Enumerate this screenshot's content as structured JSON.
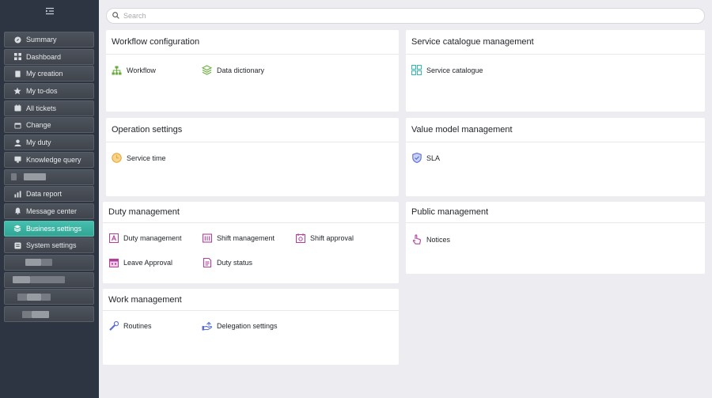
{
  "sidebar": {
    "items": [
      {
        "label": "Summary",
        "icon": "compass-icon"
      },
      {
        "label": "Dashboard",
        "icon": "grid-icon"
      },
      {
        "label": "My creation",
        "icon": "document-icon"
      },
      {
        "label": "My to-dos",
        "icon": "star-icon"
      },
      {
        "label": "All tickets",
        "icon": "ticket-icon"
      },
      {
        "label": "Change",
        "icon": "calendar-icon"
      },
      {
        "label": "My duty",
        "icon": "user-icon"
      },
      {
        "label": "Knowledge query",
        "icon": "monitor-icon"
      },
      {
        "label": "Data report",
        "icon": "bar-chart-icon"
      },
      {
        "label": "Message center",
        "icon": "bell-icon"
      },
      {
        "label": "Business settings",
        "icon": "layers-icon"
      },
      {
        "label": "System settings",
        "icon": "settings-icon"
      }
    ]
  },
  "search": {
    "placeholder": "Search"
  },
  "cards": {
    "workflow": {
      "title": "Workflow configuration",
      "items": [
        "Workflow",
        "Data dictionary"
      ]
    },
    "service_catalogue": {
      "title": "Service catalogue management",
      "items": [
        "Service catalogue"
      ]
    },
    "operation": {
      "title": "Operation settings",
      "items": [
        "Service time"
      ]
    },
    "value_model": {
      "title": "Value model management",
      "items": [
        "SLA"
      ]
    },
    "duty": {
      "title": "Duty management",
      "items": [
        "Duty management",
        "Shift management",
        "Shift approval",
        "Leave Approval",
        "Duty status"
      ]
    },
    "public": {
      "title": "Public management",
      "items": [
        "Notices"
      ]
    },
    "work": {
      "title": "Work management",
      "items": [
        "Routines",
        "Delegation settings"
      ]
    }
  },
  "colors": {
    "sidebar_bg": "#2d3442",
    "active_item": "#3fb5a5",
    "page_bg": "#ececf1",
    "workflow_green": "#6aac3c",
    "duty_purple": "#b0409a",
    "sla_blue": "#5b6fd6"
  }
}
